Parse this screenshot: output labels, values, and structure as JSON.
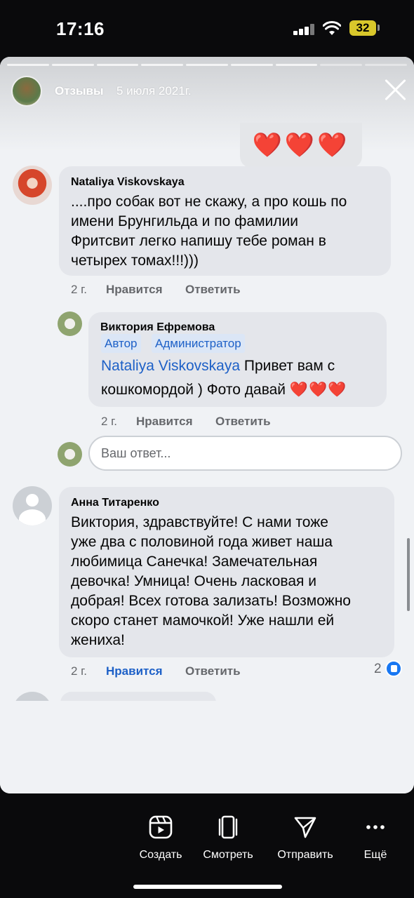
{
  "status_bar": {
    "time": "17:16",
    "battery": "32"
  },
  "story": {
    "author": "Отзывы",
    "date": "5 июля 2021г.",
    "previous_reactions": "❤️❤️❤️"
  },
  "comments": [
    {
      "author": "Nataliya Viskovskaya",
      "lines": [
        "....про собак вот не скажу, а про кошь по",
        "имени Брунгильда и по фамилии",
        "Фритсвит легко напишу тебе роман в",
        "четырех томах!!!)))"
      ],
      "time": "2 г.",
      "like": "Нравится",
      "reply": "Ответить"
    },
    {
      "author": "Виктория Ефремова",
      "badges": [
        "Автор",
        "Администратор"
      ],
      "mention": "Nataliya Viskovskaya",
      "line1_rest": " Привет вам с",
      "line2": "кошкомордой ) Фото давай ",
      "hearts": "❤️❤️❤️",
      "time": "2 г.",
      "like": "Нравится",
      "reply": "Ответить"
    },
    {
      "author": "Анна Титаренко",
      "lines": [
        "Виктория, здравствуйте! С нами тоже",
        "уже два с половиной года живет наша",
        "любимица Санечка! Замечательная",
        "девочка! Умница! Очень ласковая и",
        "добрая! Всех готова зализать! Возможно",
        "скоро станет мамочкой! Уже нашли ей",
        "жениха!"
      ],
      "time": "2 г.",
      "like": "Нравится",
      "reply": "Ответить",
      "likes_count": "2"
    }
  ],
  "reply_box": {
    "placeholder": "Ваш ответ..."
  },
  "bottom_actions": [
    {
      "label": "Создать",
      "icon": "reels-icon"
    },
    {
      "label": "Смотреть",
      "icon": "watch-icon"
    },
    {
      "label": "Отправить",
      "icon": "send-icon"
    },
    {
      "label": "Ещё",
      "icon": "more-icon"
    }
  ],
  "colors": {
    "accent": "#1d60c7",
    "heart": "#e0162b",
    "bubble": "#e4e6eb"
  }
}
